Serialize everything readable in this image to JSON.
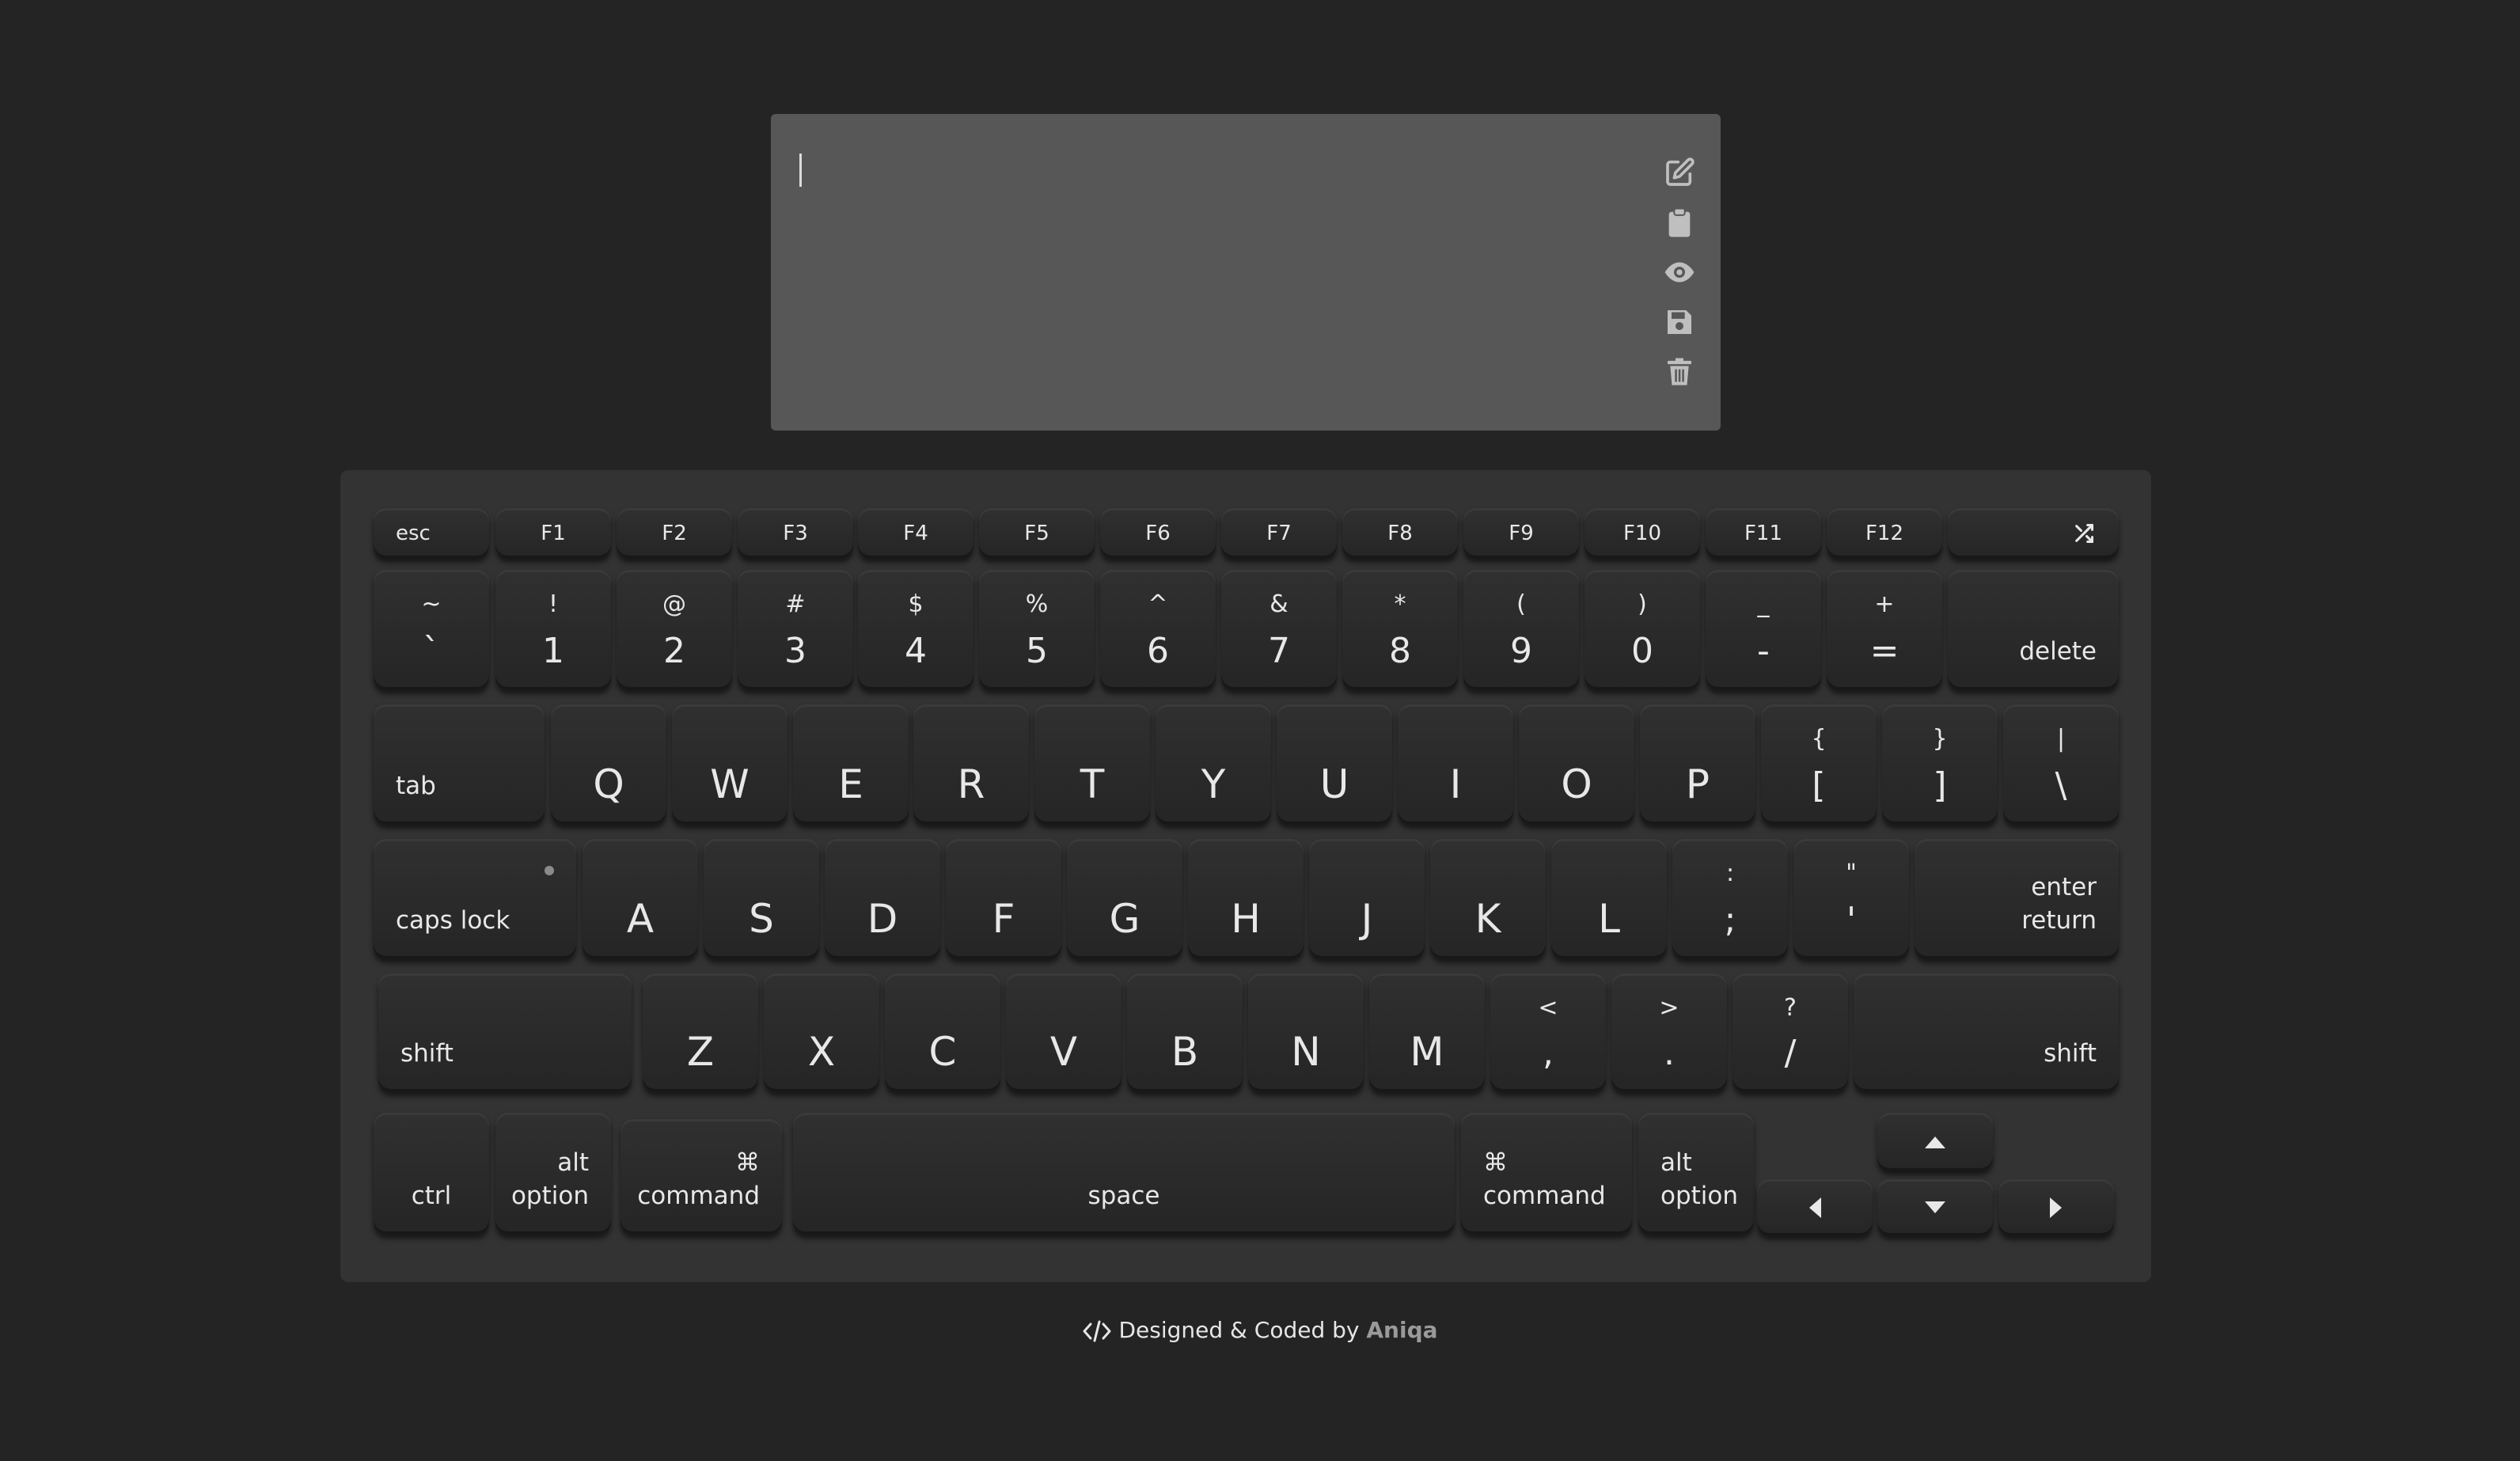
{
  "editor": {
    "content": "",
    "tools": [
      "edit-icon",
      "clipboard-icon",
      "eye-icon",
      "save-icon",
      "trash-icon"
    ]
  },
  "keyboard": {
    "row_fn": [
      "esc",
      "F1",
      "F2",
      "F3",
      "F4",
      "F5",
      "F6",
      "F7",
      "F8",
      "F9",
      "F10",
      "F11",
      "F12"
    ],
    "row_num": [
      {
        "shift": "~",
        "base": "`"
      },
      {
        "shift": "!",
        "base": "1"
      },
      {
        "shift": "@",
        "base": "2"
      },
      {
        "shift": "#",
        "base": "3"
      },
      {
        "shift": "$",
        "base": "4"
      },
      {
        "shift": "%",
        "base": "5"
      },
      {
        "shift": "^",
        "base": "6"
      },
      {
        "shift": "&",
        "base": "7"
      },
      {
        "shift": "*",
        "base": "8"
      },
      {
        "shift": "(",
        "base": "9"
      },
      {
        "shift": ")",
        "base": "0"
      },
      {
        "shift": "_",
        "base": "-"
      },
      {
        "shift": "+",
        "base": "="
      }
    ],
    "delete": "delete",
    "tab": "tab",
    "row_q": [
      "Q",
      "W",
      "E",
      "R",
      "T",
      "Y",
      "U",
      "I",
      "O",
      "P"
    ],
    "row_q_sym": [
      {
        "shift": "{",
        "base": "["
      },
      {
        "shift": "}",
        "base": "]"
      },
      {
        "shift": "|",
        "base": "\\"
      }
    ],
    "caps_lock": "caps lock",
    "row_a": [
      "A",
      "S",
      "D",
      "F",
      "G",
      "H",
      "J",
      "K",
      "L"
    ],
    "row_a_sym": [
      {
        "shift": ":",
        "base": ";"
      },
      {
        "shift": "\"",
        "base": "'"
      }
    ],
    "enter": "enter",
    "return": "return",
    "shift": "shift",
    "row_z": [
      "Z",
      "X",
      "C",
      "V",
      "B",
      "N",
      "M"
    ],
    "row_z_sym": [
      {
        "shift": "<",
        "base": ","
      },
      {
        "shift": ">",
        "base": "."
      },
      {
        "shift": "?",
        "base": "/"
      }
    ],
    "ctrl": "ctrl",
    "alt": "alt",
    "option": "option",
    "cmd_symbol": "⌘",
    "command": "command",
    "space": "space"
  },
  "footer": {
    "code_icon": "code-icon",
    "text": "Designed & Coded by",
    "author": "Aniqa"
  }
}
